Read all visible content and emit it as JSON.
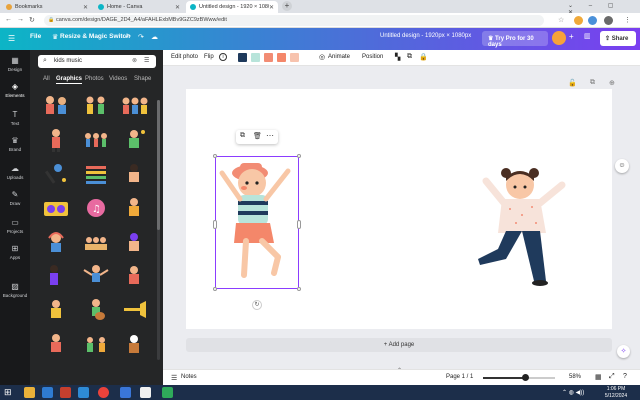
{
  "browser": {
    "tabs": [
      {
        "label": "Bookmarks",
        "active": false
      },
      {
        "label": "Home - Canva",
        "active": false
      },
      {
        "label": "Untitled design - 1920 × 1080px",
        "active": true
      }
    ],
    "new_tab": "+",
    "url": "canva.com/design/DAGE_2D4_A4/aFAHLExbMBv9GZC9zBWww/edit"
  },
  "header": {
    "file": "File",
    "resize": "Resize & Magic Switch",
    "design_title": "Untitled design - 1920px × 1080px",
    "try_pro": "Try Pro for 30 days",
    "share": "Share",
    "accent": "#8b3dff"
  },
  "rail": {
    "items": [
      {
        "label": "Design",
        "icon": "layout-icon"
      },
      {
        "label": "Elements",
        "icon": "shapes-icon"
      },
      {
        "label": "Text",
        "icon": "text-icon"
      },
      {
        "label": "Brand",
        "icon": "crown-icon"
      },
      {
        "label": "Uploads",
        "icon": "cloud-upload-icon"
      },
      {
        "label": "Draw",
        "icon": "pen-icon"
      },
      {
        "label": "Projects",
        "icon": "folder-icon"
      },
      {
        "label": "Apps",
        "icon": "grid-icon"
      },
      {
        "label": "Background",
        "icon": "background-icon"
      }
    ],
    "active": "Elements"
  },
  "panel": {
    "search_value": "kids music",
    "tabs": [
      "All",
      "Graphics",
      "Photos",
      "Videos",
      "Shape"
    ],
    "active_tab": "Graphics"
  },
  "toolbar": {
    "edit_photo": "Edit photo",
    "flip": "Flip",
    "animate": "Animate",
    "position": "Position",
    "colors": [
      "#1f3a5c",
      "#b8e4da",
      "#f28c74",
      "#f4876a",
      "#f7c3ae"
    ]
  },
  "canvas": {
    "add_page": "+ Add page"
  },
  "bottombar": {
    "notes": "Notes",
    "page_indicator": "Page 1 / 1",
    "zoom": "58%",
    "zoom_fraction": 0.58
  },
  "taskbar": {
    "time": "1:06 PM",
    "date": "5/12/2024"
  }
}
